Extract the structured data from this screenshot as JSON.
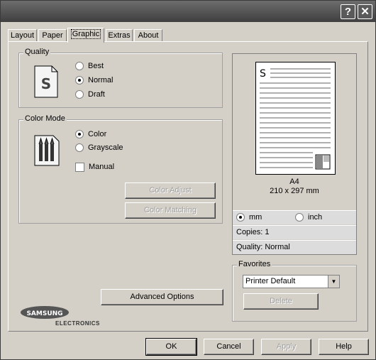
{
  "titlebar": {
    "help_label": "?",
    "close_label": "✕"
  },
  "tabs": [
    "Layout",
    "Paper",
    "Graphic",
    "Extras",
    "About"
  ],
  "quality": {
    "legend": "Quality",
    "icon_letter": "S",
    "options": [
      "Best",
      "Normal",
      "Draft"
    ],
    "selected": "Normal"
  },
  "color_mode": {
    "legend": "Color Mode",
    "options": [
      "Color",
      "Grayscale"
    ],
    "selected": "Color",
    "manual_label": "Manual",
    "color_adjust": "Color Adjust",
    "color_matching": "Color Matching"
  },
  "preview": {
    "page_letter": "S",
    "size_name": "A4",
    "size_dims": "210 x 297 mm",
    "unit_mm": "mm",
    "unit_inch": "inch",
    "copies": "Copies: 1",
    "quality": "Quality: Normal"
  },
  "favorites": {
    "legend": "Favorites",
    "selected": "Printer Default",
    "delete_label": "Delete"
  },
  "advanced_options_label": "Advanced Options",
  "logo": {
    "brand": "SAMSUNG",
    "sub": "ELECTRONICS"
  },
  "footer": {
    "ok": "OK",
    "cancel": "Cancel",
    "apply": "Apply",
    "help": "Help"
  }
}
